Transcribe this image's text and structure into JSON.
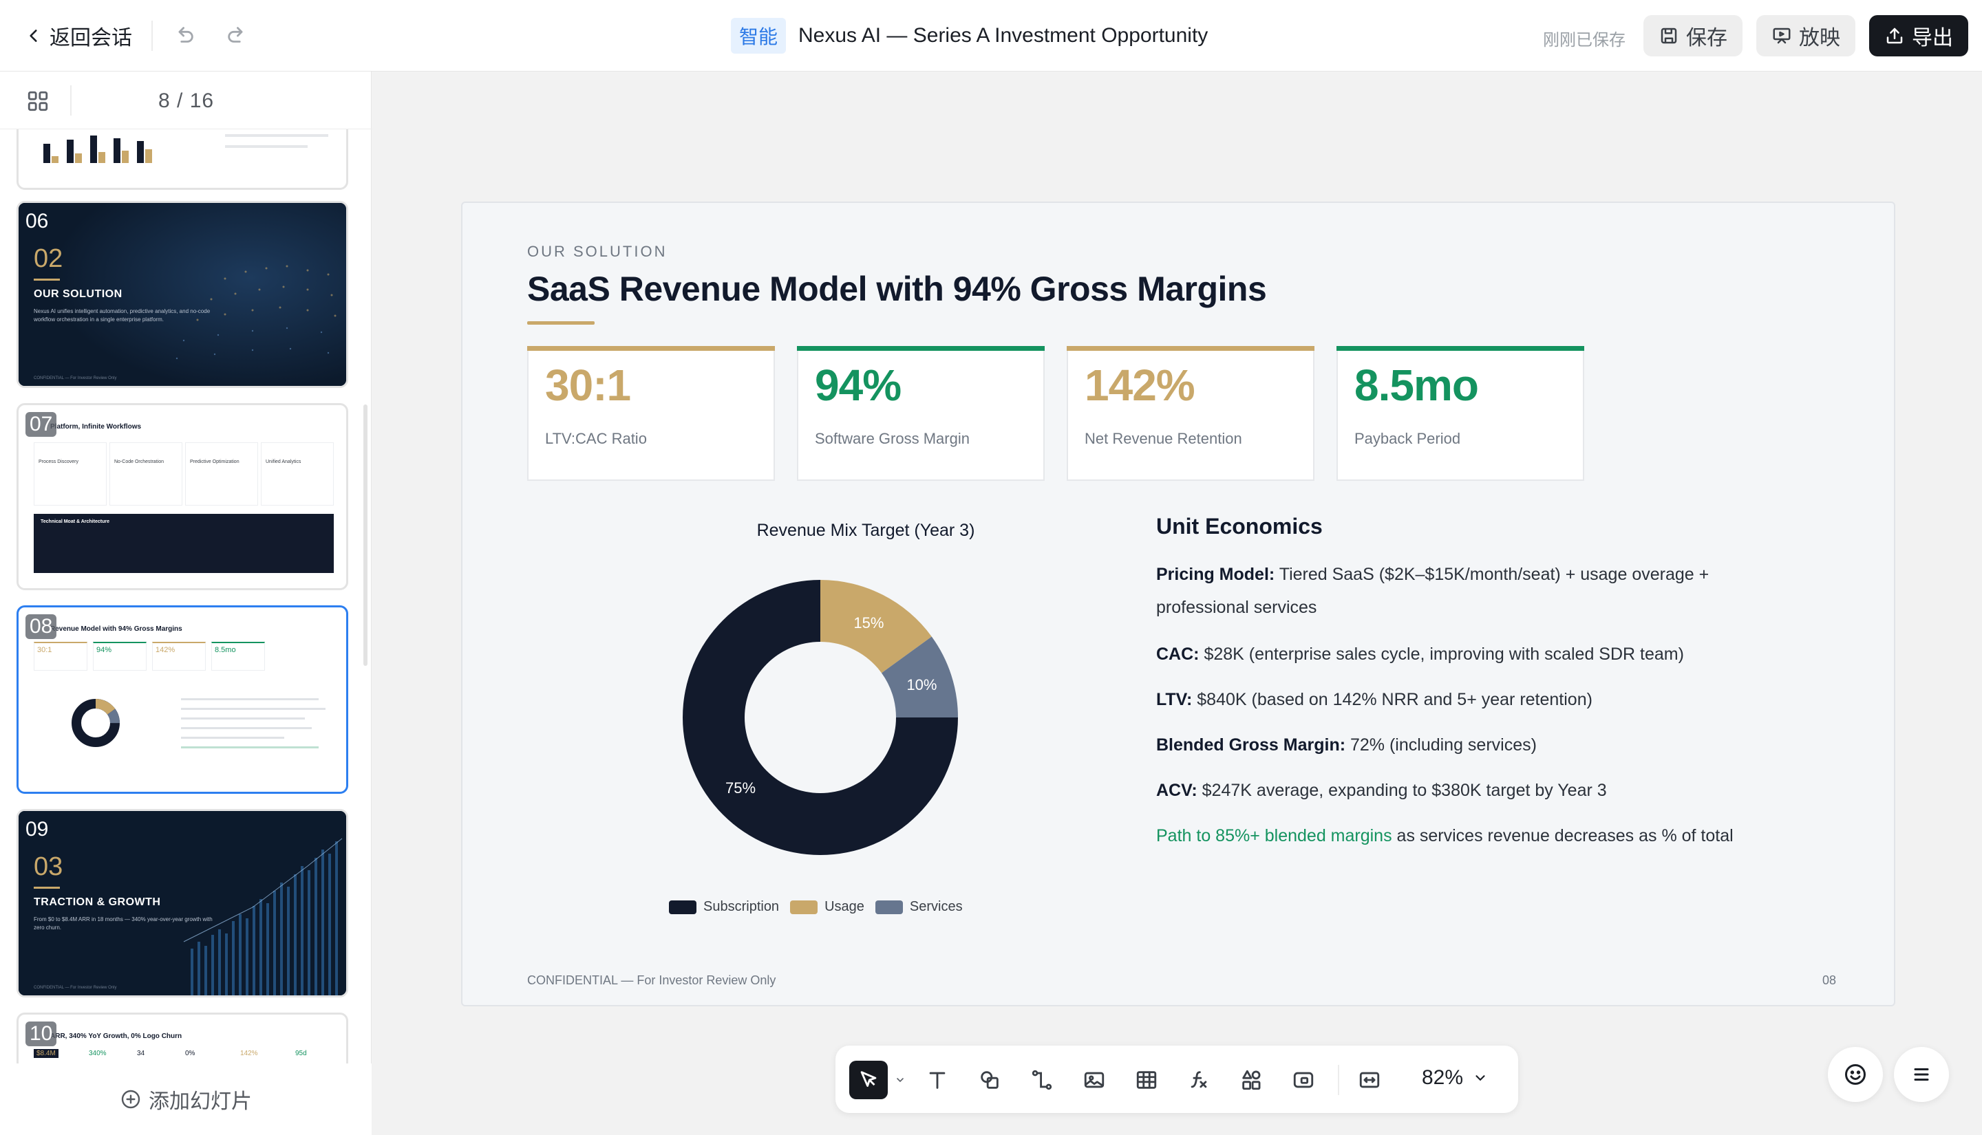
{
  "topbar": {
    "back_label": "返回会话",
    "ai_badge": "智能",
    "doc_title": "Nexus AI — Series A Investment Opportunity",
    "save_status": "刚刚已保存",
    "save_label": "保存",
    "play_label": "放映",
    "export_label": "导出"
  },
  "sidebar": {
    "page_counter": "8 / 16",
    "add_slide_label": "添加幻灯片",
    "thumbs": [
      {
        "num": "06",
        "section_num": "02",
        "heading": "OUR SOLUTION",
        "sub": "Nexus AI unifies intelligent automation, predictive analytics, and no-code workflow orchestration in a single enterprise platform.",
        "footer": "CONFIDENTIAL — For Investor Review Only"
      },
      {
        "num": "07",
        "title": "Platform, Infinite Workflows",
        "cards": [
          "Process Discovery",
          "No-Code Orchestration",
          "Predictive Optimization",
          "Unified Analytics"
        ],
        "band": "Technical Moat & Architecture"
      },
      {
        "num": "08",
        "title": "Revenue Model with 94% Gross Margins",
        "metrics": [
          "30:1",
          "94%",
          "142%",
          "8.5mo"
        ]
      },
      {
        "num": "09",
        "section_num": "03",
        "heading": "TRACTION & GROWTH",
        "sub": "From $0 to $8.4M ARR in 18 months — 340% year-over-year growth with zero churn.",
        "footer": "CONFIDENTIAL — For Investor Review Only"
      },
      {
        "num": "10",
        "title": "ARR, 340% YoY Growth, 0% Logo Churn",
        "stats": [
          "$8.4M",
          "340%",
          "34",
          "0%",
          "142%",
          "95d"
        ]
      }
    ]
  },
  "slide": {
    "eyebrow": "OUR SOLUTION",
    "title": "SaaS Revenue Model with 94% Gross Margins",
    "metrics": [
      {
        "value": "30:1",
        "label": "LTV:CAC Ratio",
        "color": "#c9a86a"
      },
      {
        "value": "94%",
        "label": "Software Gross Margin",
        "color": "#14935f"
      },
      {
        "value": "142%",
        "label": "Net Revenue Retention",
        "color": "#c9a86a"
      },
      {
        "value": "8.5mo",
        "label": "Payback Period",
        "color": "#14935f"
      }
    ],
    "unit_econ": {
      "title": "Unit Economics",
      "rows": [
        {
          "key": "Pricing Model:",
          "text": " Tiered SaaS ($2K–$15K/month/seat) + usage overage + professional services"
        },
        {
          "key": "CAC:",
          "text": " $28K (enterprise sales cycle, improving with scaled SDR team)"
        },
        {
          "key": "LTV:",
          "text": " $840K (based on 142% NRR and 5+ year retention)"
        },
        {
          "key": "Blended Gross Margin:",
          "text": " 72% (including services)"
        },
        {
          "key": "ACV:",
          "text": " $247K average, expanding to $380K target by Year 3"
        }
      ],
      "path_highlight": "Path to 85%+ blended margins",
      "path_rest": " as services revenue decreases as % of total"
    },
    "footer": "CONFIDENTIAL — For Investor Review Only",
    "page_num": "08"
  },
  "chart_data": {
    "type": "pie",
    "title": "Revenue Mix Target (Year 3)",
    "donut": true,
    "categories": [
      "Subscription",
      "Usage",
      "Services"
    ],
    "values": [
      75,
      15,
      10
    ],
    "labels": [
      "75%",
      "15%",
      "10%"
    ],
    "colors": [
      "#121a2c",
      "#c9a86a",
      "#66768f"
    ],
    "legend": "bottom"
  },
  "toolbar": {
    "zoom": "82%",
    "tools": [
      "select-icon",
      "text-icon",
      "shape-icon",
      "connector-icon",
      "image-icon",
      "table-icon",
      "formula-icon",
      "components-icon",
      "media-icon",
      "fit-icon"
    ]
  }
}
